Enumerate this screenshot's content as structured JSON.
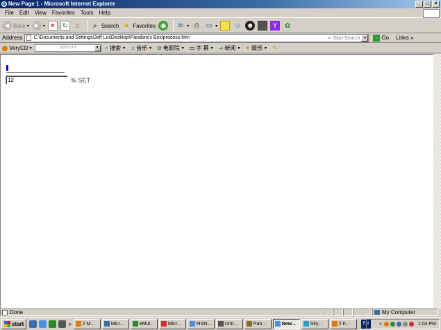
{
  "window": {
    "title": "New Page 1 - Microsoft Internet Explorer",
    "controls": {
      "minimize": "_",
      "maximize": "□",
      "close": "×"
    }
  },
  "menu": [
    "File",
    "Edit",
    "View",
    "Favorites",
    "Tools",
    "Help"
  ],
  "toolbar": {
    "back_label": "Back",
    "search_label": "Search",
    "favorites_label": "Favorites",
    "icons": [
      "back-icon",
      "forward-icon",
      "stop-icon",
      "refresh-icon",
      "home-icon",
      "search-icon",
      "favorites-icon",
      "media-icon",
      "mail-icon",
      "print-icon",
      "edit-icon",
      "folder-icon",
      "messenger-icon",
      "qq-icon",
      "toolbar-icon",
      "yahoo-icon",
      "plugin-icon"
    ]
  },
  "address": {
    "label": "Address",
    "value": "C:\\Documents and Settings\\Jeff Liu\\Desktop\\Pandora's Box\\process.htm",
    "search_hint": "Start Search",
    "go_label": "Go",
    "links_label": "Links"
  },
  "links_toolbar": {
    "brand": "VeryCD",
    "select_value": "??????",
    "items": [
      "搜索",
      "音乐",
      "电影院",
      "字 幕",
      "新闻",
      "娱乐"
    ]
  },
  "content": {
    "progress_fraction": 0.04,
    "progress_color": "#0000ee",
    "input_value": "12",
    "unit_label": "% SET"
  },
  "status": {
    "text": "Done",
    "zone": "My Computer"
  },
  "taskbar": {
    "start_label": "start",
    "tasks": [
      {
        "label": "2 M...",
        "active": false
      },
      {
        "label": "Micr...",
        "active": false
      },
      {
        "label": "eMul...",
        "active": false
      },
      {
        "label": "Micr...",
        "active": false
      },
      {
        "label": "MSN...",
        "active": false
      },
      {
        "label": "Unti...",
        "active": false
      },
      {
        "label": "Pan...",
        "active": false
      },
      {
        "label": "New...",
        "active": true
      },
      {
        "label": "Sky...",
        "active": false
      },
      {
        "label": "2 F...",
        "active": false
      }
    ],
    "language": "EN",
    "clock": "1:04 PM"
  }
}
